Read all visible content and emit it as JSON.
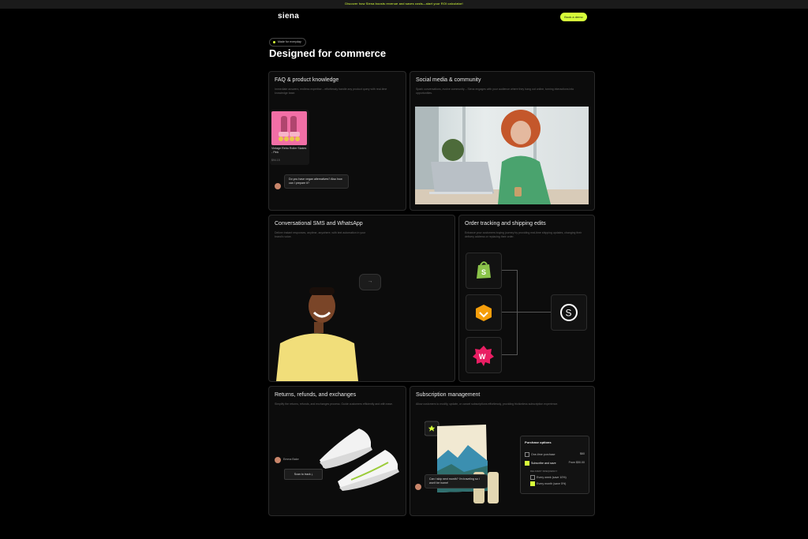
{
  "announcement": "Discover how Siena boosts revenue and saves costs—start your ROI calculator!",
  "brand": {
    "logo": "siena",
    "accent": "#d6ff3a"
  },
  "header": {
    "cta_label": "Book a demo"
  },
  "section": {
    "pill": "Made for everyday",
    "title": "Designed for commerce"
  },
  "cards": {
    "faq": {
      "title": "FAQ & product knowledge",
      "desc": "Immediate answers, endless expertise – effortlessly handle any product query with real-time knowledge base.",
      "product_name": "Vintage Retro Roller Skates - Pink",
      "product_price": "$94.15",
      "chat": "Do you have vegan alternatives? Also how can I prepare it?"
    },
    "social": {
      "title": "Social media & community",
      "desc": "Spark conversations, evolve community – Siena engages with your audience where they hang out online, turning interactions into opportunities."
    },
    "sms": {
      "title": "Conversational SMS and WhatsApp",
      "desc": "Deliver instant responses, anytime, anywhere, with text automation in your brand's voice.",
      "arrow": "→"
    },
    "orders": {
      "title": "Order tracking and shipping edits",
      "desc": "Enhance your customers buying journey by providing real-time shipping updates, changing their delivery address or replacing their order."
    },
    "returns": {
      "title": "Returns, refunds, and exchanges",
      "desc": "Simplify the returns, refunds, and exchanges process. Guide customers efficiently and with ease.",
      "customer": "Emma Bake",
      "button": "Scan to track"
    },
    "subs": {
      "title": "Subscription management",
      "desc": "Allow customers to modify, update, or cancel subscriptions effortlessly, providing frictionless subscription experience.",
      "chat": "Can I skip next month? I'm traveling so I won't be home!",
      "purchase": {
        "title": "Purchase options",
        "one_time": "One-time purchase",
        "one_time_price": "$60",
        "subscribe": "Subscribe and save",
        "subscribe_price": "From $50.00",
        "freq_label": "DELIVERY FREQUENCY",
        "weekly": "Every week (save 10%)",
        "monthly": "Every month (save 5%)"
      }
    }
  }
}
